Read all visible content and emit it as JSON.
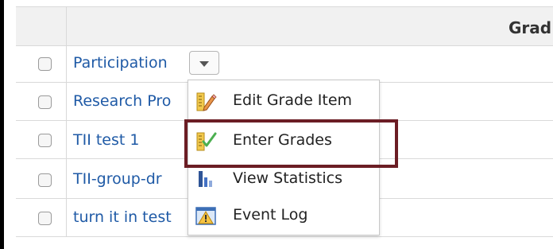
{
  "header": {
    "title": "Grad"
  },
  "grade_items": [
    {
      "label": "Participation"
    },
    {
      "label": "Research Pro"
    },
    {
      "label": "TII test 1"
    },
    {
      "label": "TII-group-dr"
    },
    {
      "label": "turn it in test"
    }
  ],
  "context_menu": {
    "items": [
      {
        "label": "Edit Grade Item",
        "icon": "edit-grade-item-icon"
      },
      {
        "label": "Enter Grades",
        "icon": "enter-grades-icon"
      },
      {
        "label": "View Statistics",
        "icon": "statistics-icon"
      },
      {
        "label": "Event Log",
        "icon": "event-log-warning-icon"
      }
    ],
    "highlighted_item": "Enter Grades"
  },
  "colors": {
    "link": "#1f5aa6",
    "highlight_border": "#6b1d24",
    "header_bg": "#f1f1f1"
  }
}
